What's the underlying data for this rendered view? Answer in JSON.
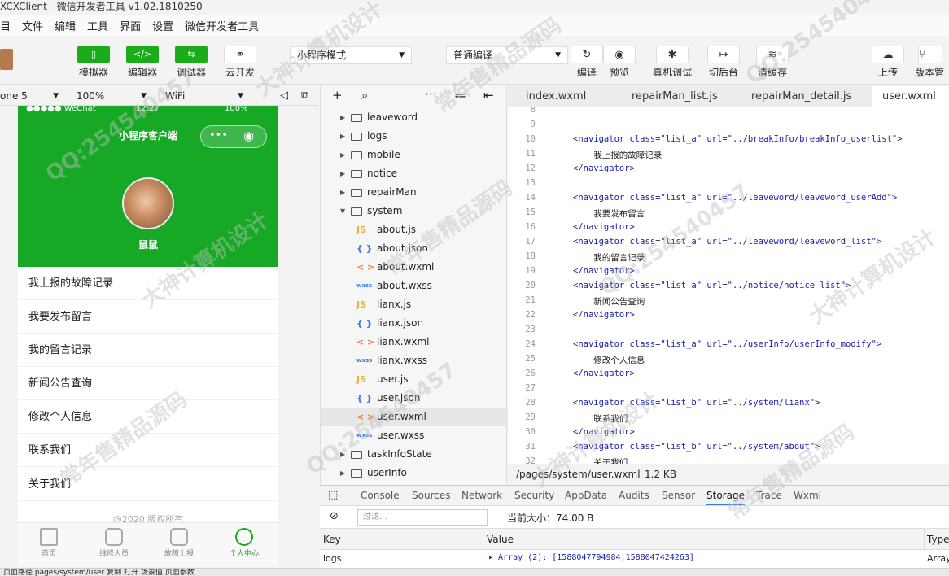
{
  "window": {
    "title": "XCXClient - 微信开发者工具 v1.02.1810250"
  },
  "menu": [
    "目",
    "文件",
    "编辑",
    "工具",
    "界面",
    "设置",
    "微信开发者工具"
  ],
  "toolbar": {
    "left_buttons": [
      {
        "label": "模拟器",
        "icon": "phone-icon"
      },
      {
        "label": "编辑器",
        "icon": "code-icon"
      },
      {
        "label": "调试器",
        "icon": "debug-icon"
      },
      {
        "label": "云开发",
        "icon": "cloud-link-icon"
      }
    ],
    "mode_select": "小程序模式",
    "compile_select": "普通编译",
    "right_buttons": [
      {
        "label": "编译",
        "icon": "refresh-icon"
      },
      {
        "label": "预览",
        "icon": "eye-icon"
      },
      {
        "label": "真机调试",
        "icon": "bug-icon"
      },
      {
        "label": "切后台",
        "icon": "switch-icon"
      },
      {
        "label": "清缓存",
        "icon": "layers-icon"
      },
      {
        "label": "上传",
        "icon": "upload-icon"
      },
      {
        "label": "版本管",
        "icon": "branch-icon"
      }
    ]
  },
  "simulator": {
    "device": "one 5",
    "zoom": "100%",
    "network": "WiFi",
    "status": {
      "carrier": "●●●●● WeChat",
      "time": "12:27",
      "battery": "100%"
    },
    "nav_title": "小程序客户端",
    "username": "鼠鼠",
    "menu_items": [
      "我上报的故障记录",
      "我要发布留言",
      "我的留言记录",
      "新闻公告查询",
      "修改个人信息",
      "联系我们",
      "关于我们"
    ],
    "footer": "@2020 版权所有",
    "tabs": [
      {
        "label": "首页",
        "icon": "home-icon"
      },
      {
        "label": "维修人员",
        "icon": "grid-icon"
      },
      {
        "label": "故障上报",
        "icon": "cart-icon"
      },
      {
        "label": "个人中心",
        "icon": "user-icon",
        "active": true
      }
    ]
  },
  "tree": {
    "items": [
      {
        "name": "leaveword",
        "type": "folder"
      },
      {
        "name": "logs",
        "type": "folder"
      },
      {
        "name": "mobile",
        "type": "folder"
      },
      {
        "name": "notice",
        "type": "folder"
      },
      {
        "name": "repairMan",
        "type": "folder"
      },
      {
        "name": "system",
        "type": "folder-open"
      },
      {
        "name": "about.js",
        "type": "js"
      },
      {
        "name": "about.json",
        "type": "json"
      },
      {
        "name": "about.wxml",
        "type": "wxml"
      },
      {
        "name": "about.wxss",
        "type": "wxss"
      },
      {
        "name": "lianx.js",
        "type": "js"
      },
      {
        "name": "lianx.json",
        "type": "json"
      },
      {
        "name": "lianx.wxml",
        "type": "wxml"
      },
      {
        "name": "lianx.wxss",
        "type": "wxss"
      },
      {
        "name": "user.js",
        "type": "js"
      },
      {
        "name": "user.json",
        "type": "json"
      },
      {
        "name": "user.wxml",
        "type": "wxml",
        "active": true
      },
      {
        "name": "user.wxss",
        "type": "wxss"
      },
      {
        "name": "taskInfoState",
        "type": "folder"
      },
      {
        "name": "userInfo",
        "type": "folder"
      }
    ]
  },
  "editor": {
    "tabs": [
      "index.wxml",
      "repairMan_list.js",
      "repairMan_detail.js",
      "user.wxml"
    ],
    "active_tab": "user.wxml",
    "lines": [
      {
        "n": "8",
        "code": ""
      },
      {
        "n": "9",
        "code": ""
      },
      {
        "n": "10",
        "code": "<navigator class=\"list_a\" url=\"../breakInfo/breakInfo_userlist\">"
      },
      {
        "n": "11",
        "code": "    我上报的故障记录"
      },
      {
        "n": "12",
        "code": "</navigator>"
      },
      {
        "n": "13",
        "code": ""
      },
      {
        "n": "14",
        "code": "<navigator class=\"list_a\" url=\"../leaveword/leaveword_userAdd\">"
      },
      {
        "n": "15",
        "code": "    我要发布留言"
      },
      {
        "n": "16",
        "code": "</navigator>"
      },
      {
        "n": "17",
        "code": "<navigator class=\"list_a\" url=\"../leaveword/leaveword_list\">"
      },
      {
        "n": "18",
        "code": "    我的留言记录"
      },
      {
        "n": "19",
        "code": "</navigator>"
      },
      {
        "n": "20",
        "code": "<navigator class=\"list_a\" url=\"../notice/notice_list\">"
      },
      {
        "n": "21",
        "code": "    新闻公告查询"
      },
      {
        "n": "22",
        "code": "</navigator>"
      },
      {
        "n": "23",
        "code": ""
      },
      {
        "n": "24",
        "code": "<navigator class=\"list_a\" url=\"../userInfo/userInfo_modify\">"
      },
      {
        "n": "25",
        "code": "    修改个人信息"
      },
      {
        "n": "26",
        "code": "</navigator>"
      },
      {
        "n": "27",
        "code": ""
      },
      {
        "n": "28",
        "code": "<navigator class=\"list_b\" url=\"../system/lianx\">"
      },
      {
        "n": "29",
        "code": "    联系我们"
      },
      {
        "n": "30",
        "code": "</navigator>"
      },
      {
        "n": "31",
        "code": "<navigator class=\"list_b\" url=\"../system/about\">"
      },
      {
        "n": "32",
        "code": "    关于我们"
      }
    ],
    "file_path": "/pages/system/user.wxml",
    "file_size": "1.2 KB"
  },
  "devtools": {
    "tabs": [
      "Console",
      "Sources",
      "Network",
      "Security",
      "AppData",
      "Audits",
      "Sensor",
      "Storage",
      "Trace",
      "Wxml"
    ],
    "active_tab": "Storage",
    "filter_placeholder": "过滤...",
    "current_size": "当前大小：74.00 B",
    "columns": [
      "Key",
      "Value",
      "Type"
    ],
    "rows": [
      {
        "key": "logs",
        "value": "▸ Array (2): [1588047794984,1588047424263]",
        "type": "Array"
      }
    ]
  },
  "bottom": {
    "text": "页面路径   pages/system/user   复制   打开       场景值        页面参数"
  },
  "watermarks": [
    "QQ:254540457",
    "大神计算机设计",
    "常年售精品源码"
  ],
  "colors": {
    "accent": "#1aad19",
    "phone_header": "#17a825",
    "link": "#3c7be0"
  }
}
